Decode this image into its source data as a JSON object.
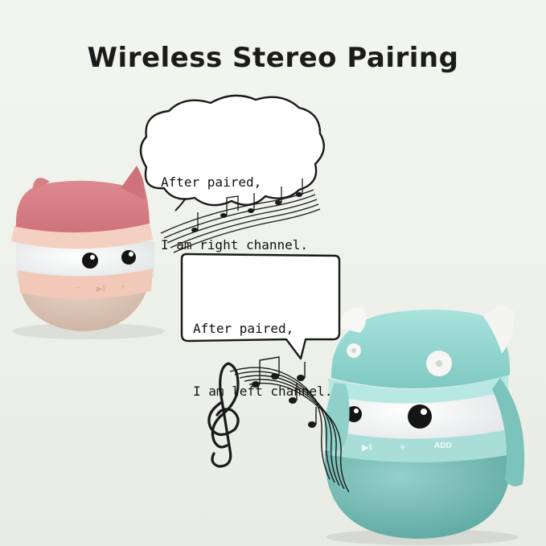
{
  "title": "Wireless Stereo Pairing",
  "bubble_right": {
    "line1": "After paired,",
    "line2": "I am right channel."
  },
  "bubble_left": {
    "line1": "After paired,",
    "line2": "I am left channel."
  },
  "teal_speaker": {
    "button_label": "ADD"
  },
  "colors": {
    "pink_hat": "#d97f86",
    "pink_band": "#f1c8b7",
    "pink_base": "#d9c3b3",
    "teal_hat": "#8fd4cf",
    "teal_base": "#77bdb6",
    "text": "#1b1b1b"
  }
}
